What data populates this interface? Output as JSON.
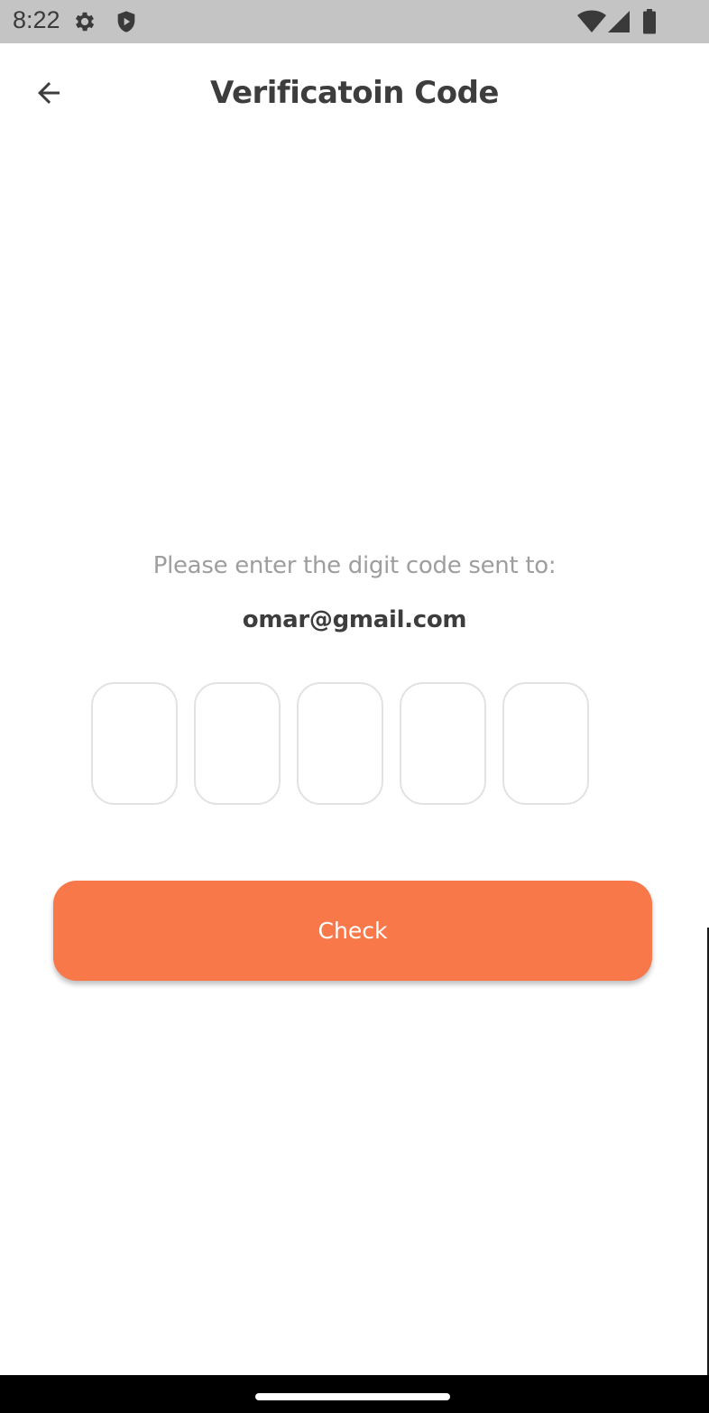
{
  "status_bar": {
    "time": "8:22",
    "icons_left": [
      "settings-gear-icon",
      "shield-play-icon"
    ],
    "icons_right": [
      "wifi-icon",
      "cellular-signal-icon",
      "battery-icon"
    ],
    "background": "#c4c4c4"
  },
  "app_bar": {
    "back_icon": "arrow-left-icon",
    "title": "Verificatoin Code"
  },
  "verification": {
    "instruction": "Please enter the digit code sent to:",
    "email": "omar@gmail.com",
    "code_digits": [
      "",
      "",
      "",
      "",
      ""
    ]
  },
  "actions": {
    "check_label": "Check"
  },
  "colors": {
    "accent": "#f8784a",
    "title_text": "#3d3d3d",
    "muted_text": "#9e9e9e",
    "box_border": "#e2e2e2"
  }
}
